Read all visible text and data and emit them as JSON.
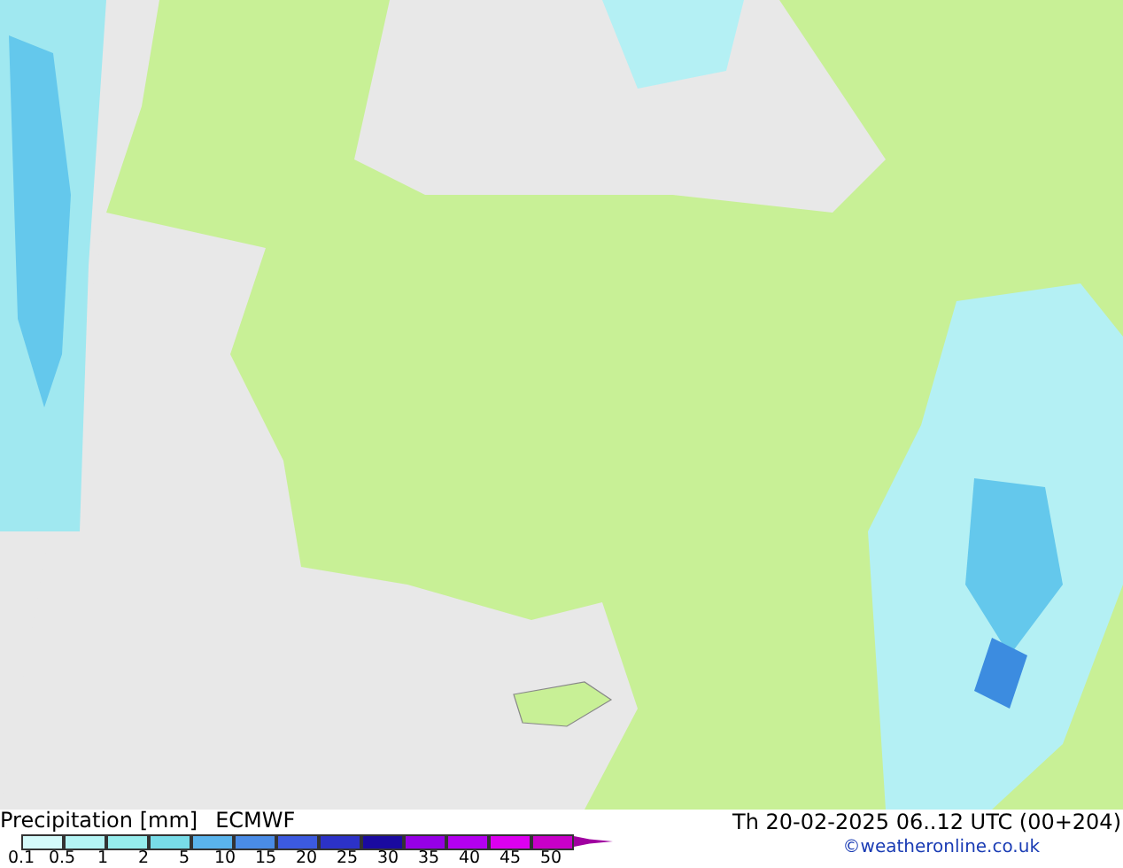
{
  "title": "Precipitation [mm]",
  "model": "ECMWF",
  "valid_time": "Th 20-02-2025 06..12 UTC (00+204)",
  "credit": "©weatheronline.co.uk",
  "legend": {
    "bins": [
      {
        "color": "#d4fafa"
      },
      {
        "color": "#b4f4f4"
      },
      {
        "color": "#96ecec"
      },
      {
        "color": "#78dce8"
      },
      {
        "color": "#5ab4ec"
      },
      {
        "color": "#4a8ce6"
      },
      {
        "color": "#3c5ae0"
      },
      {
        "color": "#2c32c8"
      },
      {
        "color": "#1a0aa0"
      },
      {
        "color": "#9600e6"
      },
      {
        "color": "#b400f0"
      },
      {
        "color": "#dc00f0"
      },
      {
        "color": "#c800c8"
      }
    ],
    "labels": [
      "0.1",
      "0.5",
      "1",
      "2",
      "5",
      "10",
      "15",
      "20",
      "25",
      "30",
      "35",
      "40",
      "45",
      "50"
    ]
  }
}
